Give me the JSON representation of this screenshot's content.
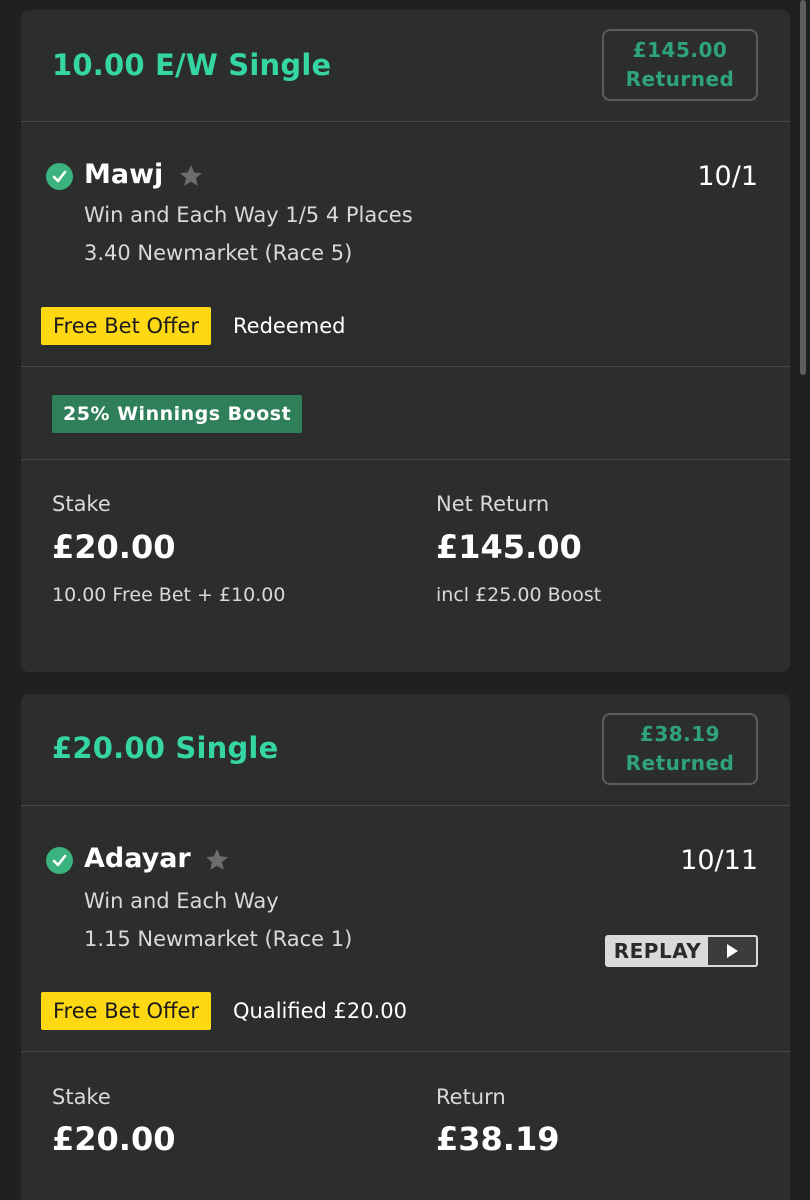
{
  "bets": [
    {
      "title": "10.00 E/W Single",
      "returned_amount": "£145.00",
      "returned_label": "Returned",
      "selection": {
        "name": "Mawj",
        "odds": "10/1",
        "market": "Win and Each Way 1/5 4 Places",
        "event": "3.40 Newmarket (Race 5)"
      },
      "free_bet_tag": "Free Bet Offer",
      "free_bet_status": "Redeemed",
      "boost_tag": "25% Winnings Boost",
      "stake_label": "Stake",
      "stake_value": "£20.00",
      "stake_sub": "10.00 Free Bet + £10.00",
      "return_label": "Net Return",
      "return_value": "£145.00",
      "return_sub": "incl £25.00 Boost"
    },
    {
      "title": "£20.00 Single",
      "returned_amount": "£38.19",
      "returned_label": "Returned",
      "selection": {
        "name": "Adayar",
        "odds": "10/11",
        "market": "Win and Each Way",
        "event": "1.15 Newmarket (Race 1)"
      },
      "replay_label": "REPLAY",
      "free_bet_tag": "Free Bet Offer",
      "free_bet_status": "Qualified £20.00",
      "stake_label": "Stake",
      "stake_value": "£20.00",
      "return_label": "Return",
      "return_value": "£38.19"
    }
  ],
  "colors": {
    "accent_green": "#35d6a3",
    "returned_green": "#2fa27e",
    "free_bet_yellow": "#ffd814",
    "boost_green": "#2f7f5a",
    "card_bg": "#2b2e2c",
    "page_bg": "#1f2120"
  },
  "icons": [
    "check-circle-icon",
    "star-icon",
    "play-icon"
  ]
}
